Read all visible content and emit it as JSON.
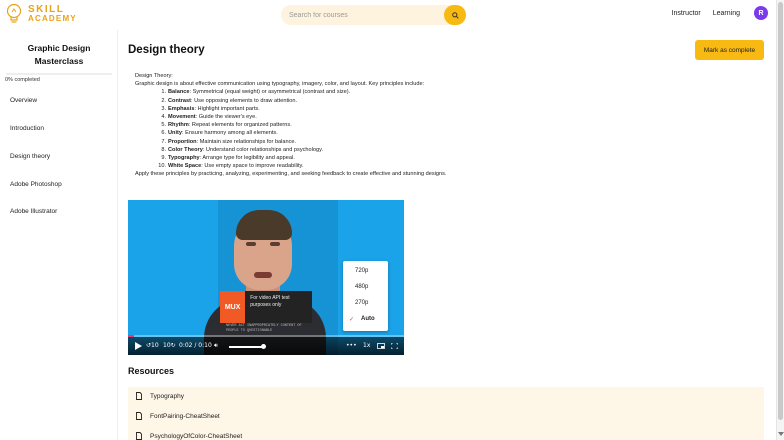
{
  "app": {
    "logo_line1": "SKILL",
    "logo_line2": "ACADEMY",
    "accent_color": "#f8b913"
  },
  "search": {
    "placeholder": "Search for courses",
    "icon": "search-icon"
  },
  "nav": {
    "instructor": "Instructor",
    "learning": "Learning",
    "avatar_initial": "R"
  },
  "sidebar": {
    "course_title": "Graphic Design Masterclass",
    "progress_text": "0% completed",
    "progress": 0,
    "items": [
      {
        "label": "Overview"
      },
      {
        "label": "Introduction"
      },
      {
        "label": "Design theory"
      },
      {
        "label": "Adobe Photoshop"
      },
      {
        "label": "Adobe Illustrator"
      }
    ]
  },
  "main": {
    "title": "Design theory",
    "complete_button": "Mark as complete",
    "intro_heading": "Design Theory:",
    "intro_text": "Graphic design is about effective communication using typography, imagery, color, and layout. Key principles include:",
    "principles": [
      {
        "num": "1.",
        "name": "Balance",
        "desc": ": Symmetrical (equal weight) or asymmetrical (contrast and size)."
      },
      {
        "num": "2.",
        "name": "Contrast",
        "desc": ": Use opposing elements to draw attention."
      },
      {
        "num": "3.",
        "name": "Emphasis",
        "desc": ": Highlight important parts."
      },
      {
        "num": "4.",
        "name": "Movement",
        "desc": ": Guide the viewer's eye."
      },
      {
        "num": "5.",
        "name": "Rhythm",
        "desc": ": Repeat elements for organized patterns."
      },
      {
        "num": "6.",
        "name": "Unity",
        "desc": ": Ensure harmony among all elements."
      },
      {
        "num": "7.",
        "name": "Proportion",
        "desc": ": Maintain size relationships for balance."
      },
      {
        "num": "8.",
        "name": "Color Theory",
        "desc": ": Understand color relationships and psychology."
      },
      {
        "num": "9.",
        "name": "Typography",
        "desc": ": Arrange type for legibility and appeal."
      },
      {
        "num": "10.",
        "name": "White Space",
        "desc": ": Use empty space to improve readability."
      }
    ],
    "closing_text": "Apply these principles by practicing, analyzing, experimenting, and seeking feedback to create effective and stunning designs."
  },
  "video": {
    "mux_logo": "MUX",
    "mux_caption": "For video API test purposes only",
    "mux_small": "NEVER ACT INAPPROPRIATELY CONTENT OF PEOPLE TO QUESTIONABLE",
    "quality_options": [
      "720p",
      "480p",
      "270p",
      "Auto"
    ],
    "quality_selected": "Auto",
    "rewind": "10",
    "forward": "10",
    "time": "0:02 / 0:10",
    "speed": "1x",
    "playback_progress": 0.02,
    "volume": 0.9
  },
  "resources": {
    "title": "Resources",
    "items": [
      {
        "label": "Typography"
      },
      {
        "label": "FontPairing-CheatSheet"
      },
      {
        "label": "PsychologyOfColor-CheatSheet"
      }
    ]
  }
}
